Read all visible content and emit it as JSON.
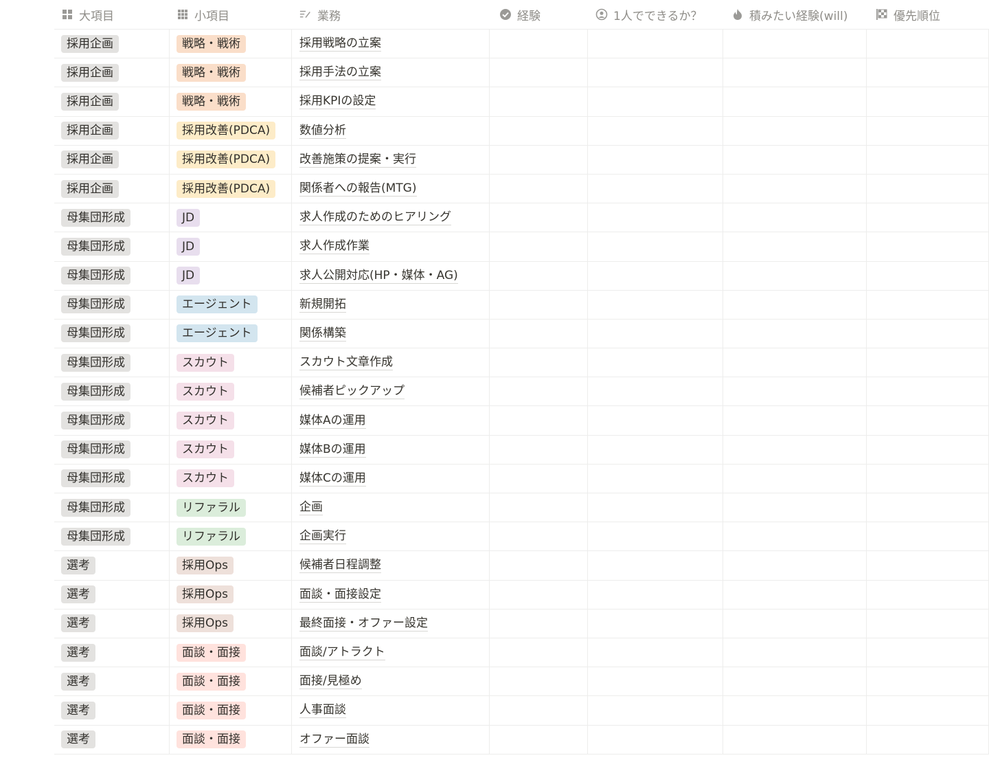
{
  "headers": [
    {
      "label": "大項目",
      "icon": "grid-icon"
    },
    {
      "label": "小項目",
      "icon": "grid-dots-icon"
    },
    {
      "label": "業務",
      "icon": "text-edit-icon"
    },
    {
      "label": "経験",
      "icon": "check-badge-icon"
    },
    {
      "label": "1人でできるか？",
      "icon": "person-circle-icon"
    },
    {
      "label": "積みたい経験(will)",
      "icon": "flame-icon"
    },
    {
      "label": "優先順位",
      "icon": "checker-icon"
    }
  ],
  "tag_colors": {
    "gray": "#e3e2e0",
    "orange": "#fadec9",
    "yellow": "#fdecc8",
    "purple": "#e8deee",
    "blue": "#d3e5ef",
    "pink": "#f5e0e9",
    "green": "#dbeddb",
    "brown": "#eee0da",
    "red": "#ffe2dd"
  },
  "rows": [
    {
      "category": "採用企画",
      "subcategory": "戦略・戦術",
      "subcolor": "orange",
      "task": "採用戦略の立案"
    },
    {
      "category": "採用企画",
      "subcategory": "戦略・戦術",
      "subcolor": "orange",
      "task": "採用手法の立案"
    },
    {
      "category": "採用企画",
      "subcategory": "戦略・戦術",
      "subcolor": "orange",
      "task": "採用KPIの設定"
    },
    {
      "category": "採用企画",
      "subcategory": "採用改善(PDCA)",
      "subcolor": "yellow",
      "task": "数値分析"
    },
    {
      "category": "採用企画",
      "subcategory": "採用改善(PDCA)",
      "subcolor": "yellow",
      "task": "改善施策の提案・実行"
    },
    {
      "category": "採用企画",
      "subcategory": "採用改善(PDCA)",
      "subcolor": "yellow",
      "task": "関係者への報告(MTG)"
    },
    {
      "category": "母集団形成",
      "subcategory": "JD",
      "subcolor": "purple",
      "task": "求人作成のためのヒアリング"
    },
    {
      "category": "母集団形成",
      "subcategory": "JD",
      "subcolor": "purple",
      "task": "求人作成作業"
    },
    {
      "category": "母集団形成",
      "subcategory": "JD",
      "subcolor": "purple",
      "task": "求人公開対応(HP・媒体・AG)"
    },
    {
      "category": "母集団形成",
      "subcategory": "エージェント",
      "subcolor": "blue",
      "task": "新規開拓"
    },
    {
      "category": "母集団形成",
      "subcategory": "エージェント",
      "subcolor": "blue",
      "task": "関係構築"
    },
    {
      "category": "母集団形成",
      "subcategory": "スカウト",
      "subcolor": "pink",
      "task": "スカウト文章作成"
    },
    {
      "category": "母集団形成",
      "subcategory": "スカウト",
      "subcolor": "pink",
      "task": "候補者ピックアップ"
    },
    {
      "category": "母集団形成",
      "subcategory": "スカウト",
      "subcolor": "pink",
      "task": "媒体Aの運用"
    },
    {
      "category": "母集団形成",
      "subcategory": "スカウト",
      "subcolor": "pink",
      "task": "媒体Bの運用"
    },
    {
      "category": "母集団形成",
      "subcategory": "スカウト",
      "subcolor": "pink",
      "task": "媒体Cの運用"
    },
    {
      "category": "母集団形成",
      "subcategory": "リファラル",
      "subcolor": "green",
      "task": "企画"
    },
    {
      "category": "母集団形成",
      "subcategory": "リファラル",
      "subcolor": "green",
      "task": "企画実行"
    },
    {
      "category": "選考",
      "subcategory": "採用Ops",
      "subcolor": "brown",
      "task": "候補者日程調整"
    },
    {
      "category": "選考",
      "subcategory": "採用Ops",
      "subcolor": "brown",
      "task": "面談・面接設定"
    },
    {
      "category": "選考",
      "subcategory": "採用Ops",
      "subcolor": "brown",
      "task": "最終面接・オファー設定"
    },
    {
      "category": "選考",
      "subcategory": "面談・面接",
      "subcolor": "red",
      "task": "面談/アトラクト"
    },
    {
      "category": "選考",
      "subcategory": "面談・面接",
      "subcolor": "red",
      "task": "面接/見極め"
    },
    {
      "category": "選考",
      "subcategory": "面談・面接",
      "subcolor": "red",
      "task": "人事面談"
    },
    {
      "category": "選考",
      "subcategory": "面談・面接",
      "subcolor": "red",
      "task": "オファー面談"
    }
  ]
}
